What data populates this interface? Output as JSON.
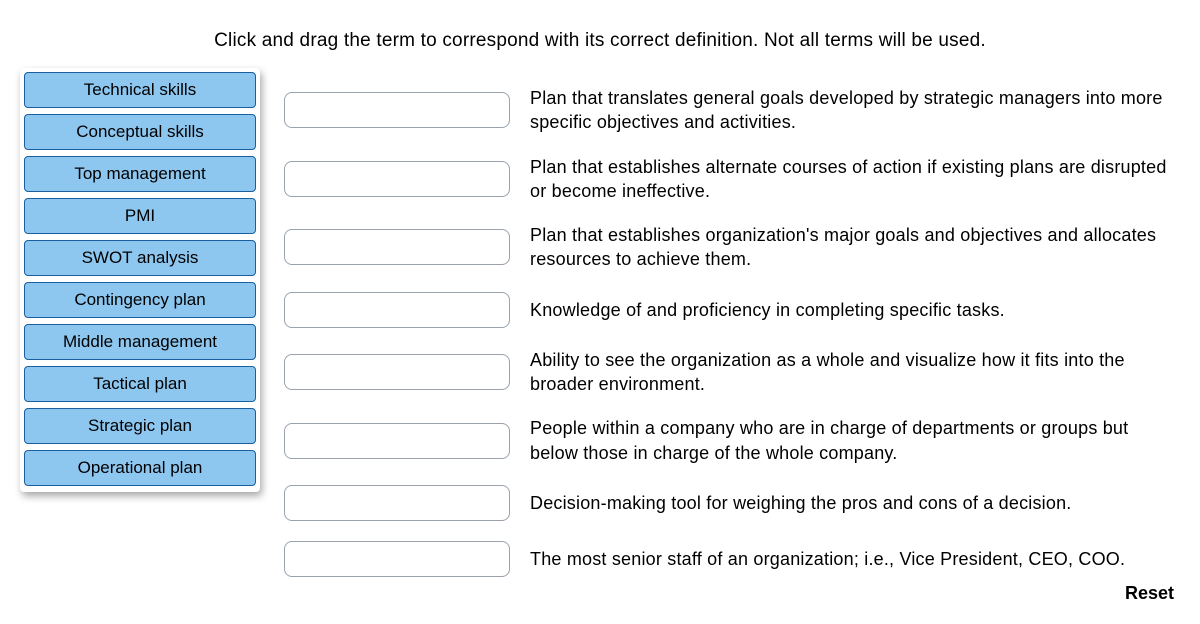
{
  "instructions": "Click and drag the term to correspond with its correct definition. Not all terms will be used.",
  "terms": [
    "Technical skills",
    "Conceptual skills",
    "Top management",
    "PMI",
    "SWOT analysis",
    "Contingency plan",
    "Middle management",
    "Tactical plan",
    "Strategic plan",
    "Operational plan"
  ],
  "definitions": [
    "Plan that translates general goals developed by strategic managers into more specific objectives and activities.",
    "Plan that establishes alternate courses of action if existing plans are disrupted or become ineffective.",
    "Plan that establishes organization's major goals and objectives and allocates resources to achieve them.",
    "Knowledge of and proficiency in completing specific tasks.",
    "Ability to see the organization as a whole and visualize how it fits into the broader environment.",
    "People within a company who are in charge of departments or groups but below those in charge of the whole company.",
    "Decision-making tool for weighing the pros and cons of a decision.",
    "The most senior staff of an organization; i.e., Vice President, CEO, COO."
  ],
  "reset_label": "Reset"
}
